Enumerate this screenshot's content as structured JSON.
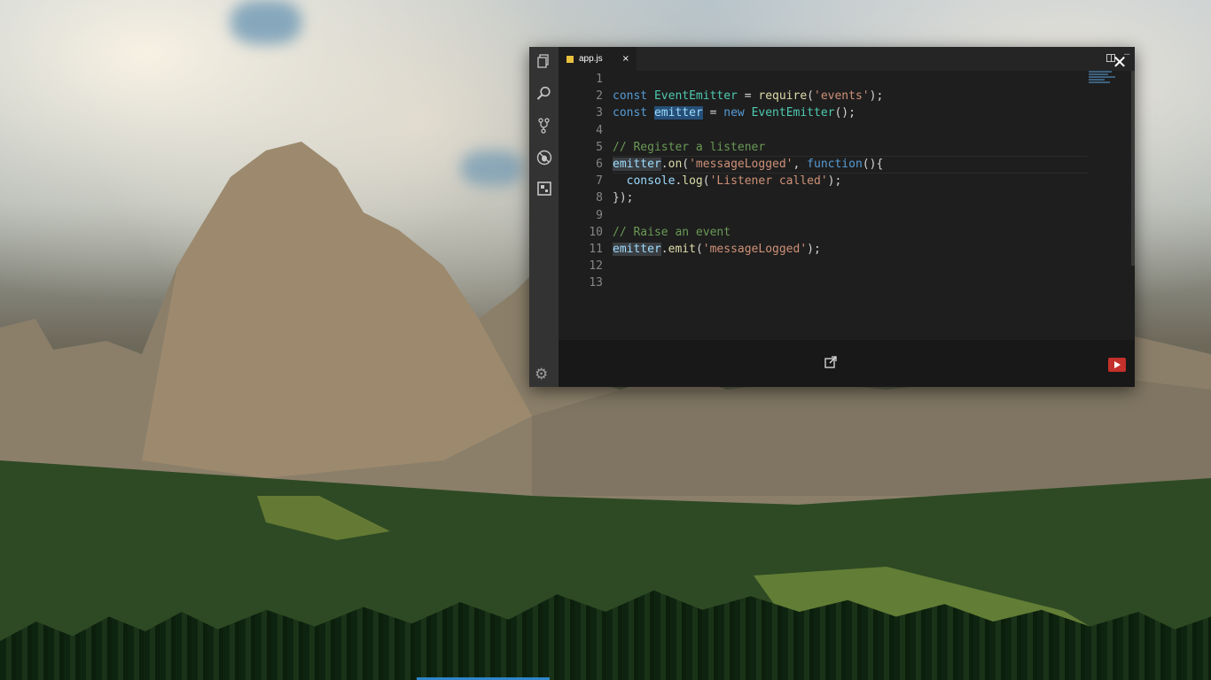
{
  "editor": {
    "tab": {
      "label": "app.js",
      "close": "×"
    },
    "code_lines": [
      {
        "n": "1"
      },
      {
        "n": "2"
      },
      {
        "n": "3"
      },
      {
        "n": "4"
      },
      {
        "n": "5"
      },
      {
        "n": "6"
      },
      {
        "n": "7"
      },
      {
        "n": "8"
      },
      {
        "n": "9"
      },
      {
        "n": "10"
      },
      {
        "n": "11"
      },
      {
        "n": "12"
      },
      {
        "n": "13"
      }
    ],
    "code": {
      "l2_kw": "const",
      "l2_cls": "EventEmitter",
      "l2_op": " = ",
      "l2_fn": "require",
      "l2_open": "(",
      "l2_str": "'events'",
      "l2_close": ");",
      "l3_kw": "const",
      "l3_var": "emitter",
      "l3_op": " = ",
      "l3_new": "new",
      "l3_cls": "EventEmitter",
      "l3_close": "();",
      "l5_cm": "// Register a listener",
      "l6_var": "emitter",
      "l6_dot": ".",
      "l6_fn": "on",
      "l6_open": "(",
      "l6_str": "'messageLogged'",
      "l6_comma": ", ",
      "l6_kw": "function",
      "l6_close": "(){",
      "l7_indent": "  ",
      "l7_var": "console",
      "l7_dot": ".",
      "l7_fn": "log",
      "l7_open": "(",
      "l7_str": "'Listener called'",
      "l7_close": ");",
      "l8": "});",
      "l10_cm": "// Raise an event",
      "l11_var": "emitter",
      "l11_dot": ".",
      "l11_fn": "emit",
      "l11_open": "(",
      "l11_str": "'messageLogged'",
      "l11_close": ");"
    }
  },
  "icons": {
    "activity": [
      "files-icon",
      "search-icon",
      "source-control-icon",
      "debug-icon",
      "extensions-icon"
    ],
    "settings": "gear-icon",
    "footer_external": "external-link-icon",
    "footer_logo": "youtube-logo-icon"
  },
  "colors": {
    "editor_bg": "#1e1e1e",
    "activity_bg": "#333333",
    "keyword": "#569cd6",
    "class": "#4ec9b0",
    "string": "#ce9178",
    "function": "#dcdcaa",
    "comment": "#6a9955",
    "variable": "#9cdcfe"
  }
}
